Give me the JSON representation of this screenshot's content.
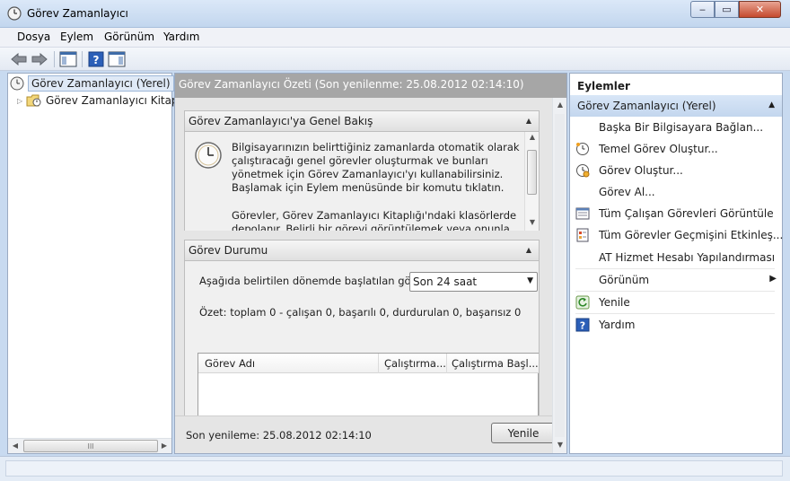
{
  "window": {
    "title": "Görev Zamanlayıcı",
    "min": "‒",
    "max": "▭",
    "close": "✕"
  },
  "menu": [
    "Dosya",
    "Eylem",
    "Görünüm",
    "Yardım"
  ],
  "tree": {
    "root": "Görev Zamanlayıcı (Yerel)",
    "child": "Görev Zamanlayıcı Kitaplığı"
  },
  "left_hscroll": {
    "grip": "III"
  },
  "center": {
    "header": "Görev Zamanlayıcı Özeti (Son yenilenme: 25.08.2012 02:14:10)",
    "overview": {
      "title": "Görev Zamanlayıcı'ya Genel Bakış",
      "p1": "Bilgisayarınızın belirttiğiniz zamanlarda otomatik olarak çalıştıracağı genel görevler oluşturmak ve bunları yönetmek için Görev Zamanlayıcı'yı kullanabilirsiniz. Başlamak için Eylem menüsünde bir komutu tıklatın.",
      "p2": "Görevler, Görev Zamanlayıcı Kitaplığı'ndaki klasörlerde depolanır. Belirli bir görevi görüntülemek veya onunla ilgili"
    },
    "status": {
      "title": "Görev Durumu",
      "filter_label": "Aşağıda belirtilen dönemde başlatılan gö...",
      "filter_value": "Son 24 saat",
      "summary": "Özet: toplam 0 - çalışan 0, başarılı 0, durdurulan 0, başarısız 0",
      "columns": [
        "Görev Adı",
        "Çalıştırma...",
        "Çalıştırma Başl..."
      ]
    },
    "footer": {
      "last_refresh": "Son yenileme: 25.08.2012 02:14:10",
      "refresh_button": "Yenile"
    }
  },
  "actions": {
    "title": "Eylemler",
    "subtitle": "Görev Zamanlayıcı (Yerel)",
    "items": [
      {
        "label": "Başka Bir Bilgisayara Bağlan...",
        "icon": "none"
      },
      {
        "label": "Temel Görev Oluştur...",
        "icon": "clock-wizard-icon"
      },
      {
        "label": "Görev Oluştur...",
        "icon": "clock-new-icon"
      },
      {
        "label": "Görev Al...",
        "icon": "none"
      },
      {
        "label": "Tüm Çalışan Görevleri Görüntüle",
        "icon": "running-tasks-icon"
      },
      {
        "label": "Tüm Görevler Geçmişini Etkinleş...",
        "icon": "history-icon"
      },
      {
        "label": "AT Hizmet Hesabı Yapılandırması",
        "icon": "none"
      },
      {
        "label": "Görünüm",
        "icon": "none"
      },
      {
        "label": "Yenile",
        "icon": "refresh-icon"
      },
      {
        "label": "Yardım",
        "icon": "help-icon"
      }
    ]
  },
  "colors": {
    "accent": "#c3d6ee",
    "header_gray": "#a6a6a6",
    "close": "#c54a2e"
  }
}
